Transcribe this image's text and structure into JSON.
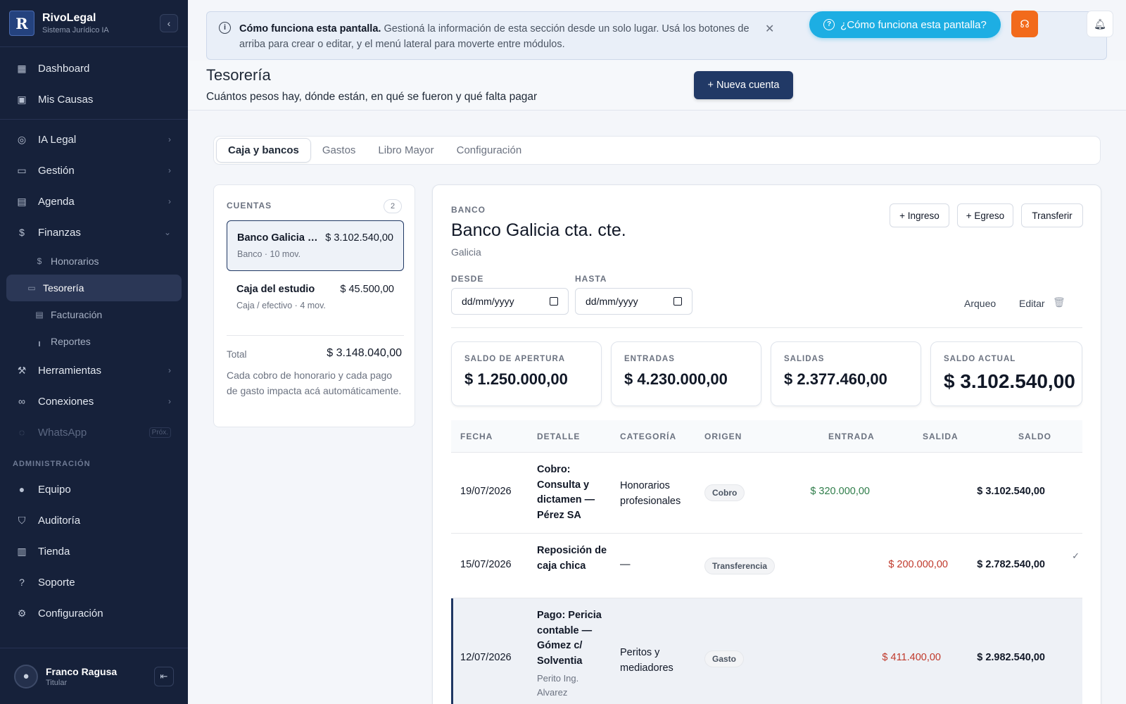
{
  "app": {
    "name": "RivoLegal",
    "subtitle": "Sistema Jurídico IA",
    "logo": "R"
  },
  "sidebar": {
    "items": [
      {
        "label": "Dashboard",
        "icon": "grid-icon"
      },
      {
        "label": "Mis Causas",
        "icon": "briefcase-icon"
      },
      {
        "label": "IA Legal",
        "icon": "robot-icon"
      },
      {
        "label": "Gestión",
        "icon": "suitcase-icon"
      },
      {
        "label": "Agenda",
        "icon": "calendar-icon"
      },
      {
        "label": "Finanzas",
        "icon": "dollar-icon"
      }
    ],
    "finanzas_sub": [
      {
        "label": "Honorarios",
        "icon": "dollar-icon"
      },
      {
        "label": "Tesorería",
        "icon": "wallet-icon"
      },
      {
        "label": "Facturación",
        "icon": "invoice-icon"
      },
      {
        "label": "Reportes",
        "icon": "bar-chart-icon"
      }
    ],
    "items2": [
      {
        "label": "Herramientas",
        "icon": "wrench-icon"
      },
      {
        "label": "Conexiones",
        "icon": "link-icon"
      },
      {
        "label": "WhatsApp",
        "icon": "whatsapp-icon",
        "badge": "Próx."
      }
    ],
    "admin_label": "ADMINISTRACIÓN",
    "admin_items": [
      {
        "label": "Equipo",
        "icon": "person-icon"
      },
      {
        "label": "Auditoría",
        "icon": "shield-icon"
      },
      {
        "label": "Tienda",
        "icon": "store-icon"
      },
      {
        "label": "Soporte",
        "icon": "help-circle-icon"
      },
      {
        "label": "Configuración",
        "icon": "gear-icon"
      }
    ],
    "user": {
      "name": "Franco Ragusa",
      "role": "Titular"
    }
  },
  "infobar": {
    "title": "Cómo funciona esta pantalla.",
    "text": "Gestioná la información de esta sección desde un solo lugar. Usá los botones de arriba para crear o editar, y el menú lateral para moverte entre módulos."
  },
  "help_button": "¿Cómo funciona esta pantalla?",
  "page": {
    "title": "Tesorería",
    "subtitle": "Cuántos pesos hay, dónde están, en qué se fueron y qué falta pagar",
    "new_button": "+ Nueva cuenta"
  },
  "tabs": [
    "Caja y bancos",
    "Gastos",
    "Libro Mayor",
    "Configuración"
  ],
  "accounts": {
    "header": "CUENTAS",
    "count": "2",
    "list": [
      {
        "name": "Banco Galicia cta. cte.",
        "amount": "$ 3.102.540,00",
        "meta": "Banco · 10 mov."
      },
      {
        "name": "Caja del estudio",
        "amount": "$ 45.500,00",
        "meta": "Caja / efectivo · 4 mov."
      }
    ],
    "total_label": "Total",
    "total": "$ 3.148.040,00",
    "note": "Cada cobro de honorario y cada pago de gasto impacta acá automáticamente."
  },
  "detail": {
    "kind": "BANCO",
    "title": "Banco Galicia cta. cte.",
    "bank": "Galicia",
    "buttons": {
      "ingreso": "+ Ingreso",
      "egreso": "+ Egreso",
      "transferir": "Transferir"
    },
    "from_label": "DESDE",
    "to_label": "HASTA",
    "date_placeholder": "dd/mm/yyyy",
    "arqueo": "Arqueo",
    "editar": "Editar",
    "stats": [
      {
        "label": "SALDO DE APERTURA",
        "value": "$ 1.250.000,00"
      },
      {
        "label": "ENTRADAS",
        "value": "$ 4.230.000,00"
      },
      {
        "label": "SALIDAS",
        "value": "$ 2.377.460,00"
      },
      {
        "label": "SALDO ACTUAL",
        "value": "$ 3.102.540,00"
      }
    ],
    "columns": [
      "FECHA",
      "DETALLE",
      "CATEGORÍA",
      "ORIGEN",
      "ENTRADA",
      "SALIDA",
      "SALDO"
    ],
    "rows": [
      {
        "date": "19/07/2026",
        "detail": "Cobro: Consulta y dictamen — Pérez SA",
        "sub": "",
        "category": "Honorarios profesionales",
        "origin": "Cobro",
        "in": "$ 320.000,00",
        "out": "",
        "balance": "$ 3.102.540,00"
      },
      {
        "date": "15/07/2026",
        "detail": "Reposición de caja chica",
        "sub": "",
        "category": "—",
        "origin": "Transferencia",
        "in": "",
        "out": "$ 200.000,00",
        "balance": "$ 2.782.540,00"
      },
      {
        "date": "12/07/2026",
        "detail": "Pago: Pericia contable — Gómez c/ Solventia",
        "sub": "Perito Ing. Alvarez",
        "category": "Peritos y mediadores",
        "origin": "Gasto",
        "in": "",
        "out": "$ 411.400,00",
        "balance": "$ 2.982.540,00"
      }
    ]
  }
}
